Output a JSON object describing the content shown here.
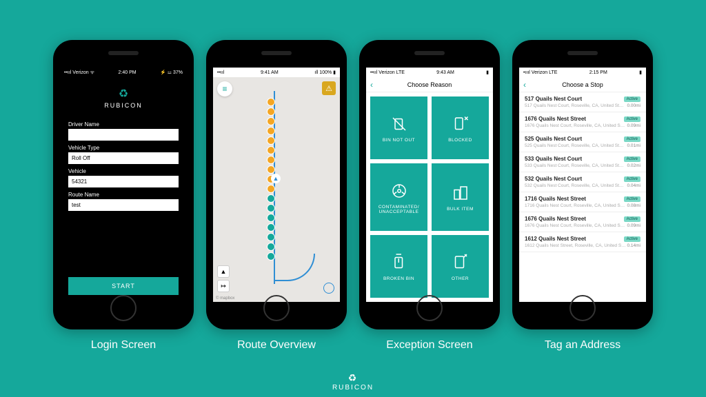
{
  "brand": "RUBICON",
  "captions": [
    "Login Screen",
    "Route Overview",
    "Exception Screen",
    "Tag an Address"
  ],
  "login": {
    "status": {
      "left": "••ııl Verizon ᯤ",
      "center": "2:40 PM",
      "right": "⚡ ⚍ 37%"
    },
    "fields": {
      "driver_label": "Driver Name",
      "driver_value": "",
      "vehicle_type_label": "Vehicle Type",
      "vehicle_type_value": "Roll Off",
      "vehicle_label": "Vehicle",
      "vehicle_value": "54321",
      "route_label": "Route Name",
      "route_value": "test"
    },
    "start_label": "START"
  },
  "route": {
    "status": {
      "left": "••ııl",
      "center": "9:41 AM",
      "right": "ıll 100% ▮"
    },
    "attrib": "© mapbox"
  },
  "exception": {
    "status": {
      "left": "••ııl Verizon LTE",
      "center": "9:43 AM",
      "right": "▮"
    },
    "title": "Choose Reason",
    "tiles": [
      {
        "label": "BIN NOT OUT"
      },
      {
        "label": "BLOCKED"
      },
      {
        "label": "CONTAMINATED/\nUNACCEPTABLE"
      },
      {
        "label": "BULK ITEM"
      },
      {
        "label": "BROKEN BIN"
      },
      {
        "label": "OTHER"
      }
    ]
  },
  "tag": {
    "status": {
      "left": "•ıııl Verizon LTE",
      "center": "2:15 PM",
      "right": "▮"
    },
    "title": "Choose a Stop",
    "badge": "Active",
    "stops": [
      {
        "name": "517 Quails Nest Court",
        "sub": "517 Quails Nest Court, Roseville, CA, United St…",
        "dist": "0.00mi"
      },
      {
        "name": "1676 Quails Nest Street",
        "sub": "1676 Quails Nest Court, Roseville, CA, United S…",
        "dist": "0.09mi"
      },
      {
        "name": "525 Quails Nest Court",
        "sub": "525 Quails Nest Court, Roseville, CA, United St…",
        "dist": "0.01mi"
      },
      {
        "name": "533 Quails Nest Court",
        "sub": "533 Quails Nest Court, Roseville, CA, United St…",
        "dist": "0.02mi"
      },
      {
        "name": "532 Quails Nest Court",
        "sub": "532 Quails Nest Court, Roseville, CA, United St…",
        "dist": "0.04mi"
      },
      {
        "name": "1716 Quails Nest Street",
        "sub": "1716 Quails Nest Court, Roseville, CA, United S…",
        "dist": "0.08mi"
      },
      {
        "name": "1676 Quails Nest Street",
        "sub": "1676 Quails Nest Court, Roseville, CA, United S…",
        "dist": "0.09mi"
      },
      {
        "name": "1612 Quails Nest Street",
        "sub": "1612 Quails Nest Street, Roseville, CA, United S…",
        "dist": "0.14mi"
      }
    ]
  }
}
